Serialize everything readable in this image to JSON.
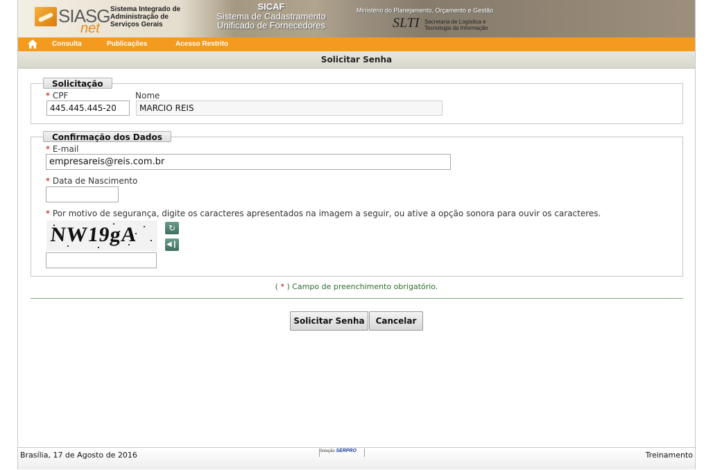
{
  "header": {
    "logo_main": "SIASG",
    "logo_sub": "net",
    "system_name_lines": [
      "Sistema Integrado de",
      "Administração de",
      "Serviços Gerais"
    ],
    "sicaf": "SICAF",
    "sicaf_line1": "Sistema de Cadastramento",
    "sicaf_line2": "Unificado de Fornecedores",
    "ministerio": "Ministério do Planejamento, Orçamento e Gestão",
    "slti": "SLTI",
    "slti_sub_lines": [
      "Secretaria de Logística e",
      "Tecnologia da Informação"
    ]
  },
  "nav": {
    "items": [
      {
        "label": "Consulta"
      },
      {
        "label": "Publicações"
      },
      {
        "label": "Acesso Restrito"
      }
    ]
  },
  "page_title": "Solicitar Senha",
  "solicitacao": {
    "legend": "Solicitação",
    "cpf_label": "CPF",
    "cpf_value": "445.445.445-20",
    "nome_label": "Nome",
    "nome_value": "MARCIO REIS"
  },
  "confirmacao": {
    "legend": "Confirmação dos Dados",
    "email_label": "E-mail",
    "email_value": "empresareis@reis.com.br",
    "nascimento_label": "Data de Nascimento",
    "nascimento_value": "",
    "captcha_instruction": "Por motivo de segurança, digite os caracteres apresentados na imagem a seguir, ou ative a opção sonora para ouvir os caracteres.",
    "captcha_text": "NW19gA",
    "captcha_value": ""
  },
  "required_asterisk": "*",
  "required_note_prefix": "(",
  "required_note_suffix": ") Campo de preenchimento obrigatório.",
  "buttons": {
    "submit": "Solicitar Senha",
    "cancel": "Cancelar"
  },
  "footer": {
    "date": "Brasília, 17 de Agosto de 2016",
    "solucao": "Solução",
    "serpro": "SERPRO",
    "environment": "Treinamento"
  },
  "icons": {
    "home": "home-icon",
    "refresh": "refresh-icon",
    "audio": "audio-icon"
  },
  "colors": {
    "nav_bg": "#f49a1e",
    "required": "#c00000",
    "note": "#2a6d2a"
  }
}
